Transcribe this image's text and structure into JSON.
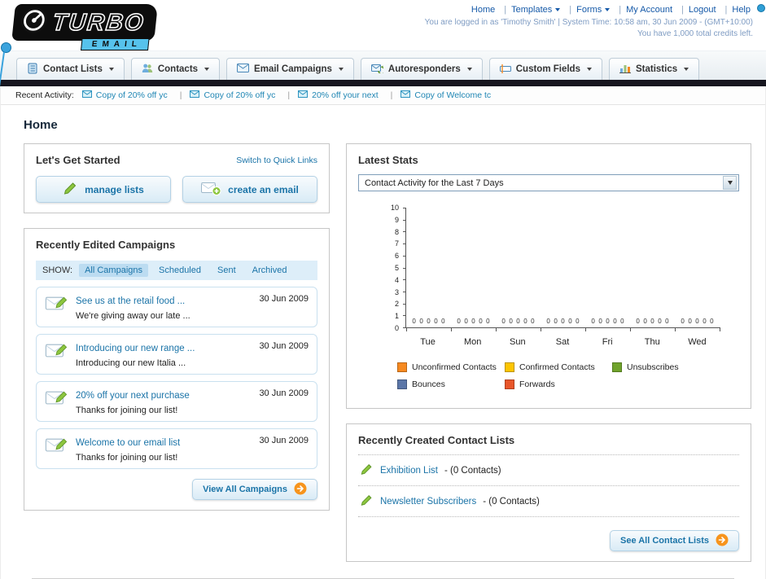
{
  "header": {
    "logo": {
      "title": "TURBO",
      "subtitle": "EMAIL"
    },
    "links": [
      "Home",
      "Templates",
      "Forms",
      "My Account",
      "Logout",
      "Help"
    ],
    "login_info": "You are logged in as 'Timothy Smith' | System Time: 10:58 am, 30 Jun 2009 - (GMT+10:00)",
    "credits_info": "You have 1,000 total credits left."
  },
  "nav": {
    "tabs": [
      {
        "label": "Contact Lists"
      },
      {
        "label": "Contacts"
      },
      {
        "label": "Email Campaigns"
      },
      {
        "label": "Autoresponders"
      },
      {
        "label": "Custom Fields"
      },
      {
        "label": "Statistics"
      }
    ]
  },
  "recent_activity": {
    "label": "Recent Activity:",
    "items": [
      {
        "text": "Copy of 20% off yc"
      },
      {
        "text": "Copy of 20% off yc"
      },
      {
        "text": "20% off your next"
      },
      {
        "text": "Copy of Welcome tc"
      }
    ]
  },
  "page": {
    "title": "Home"
  },
  "get_started": {
    "title": "Let's Get Started",
    "switch_link": "Switch to Quick Links",
    "manage_lists_label": "manage lists",
    "create_email_label": "create an email"
  },
  "campaigns": {
    "title": "Recently Edited Campaigns",
    "show_label": "SHOW:",
    "filters": [
      {
        "label": "All Campaigns"
      },
      {
        "label": "Scheduled"
      },
      {
        "label": "Sent"
      },
      {
        "label": "Archived"
      }
    ],
    "items": [
      {
        "title": "See us at the retail food ...",
        "subtitle": "We're giving away our late ...",
        "date": "30 Jun 2009"
      },
      {
        "title": "Introducing our new range ...",
        "subtitle": "Introducing our new Italia ...",
        "date": "30 Jun 2009"
      },
      {
        "title": "20% off your next purchase",
        "subtitle": "Thanks for joining our list!",
        "date": "30 Jun 2009"
      },
      {
        "title": "Welcome to our email list",
        "subtitle": "Thanks for joining our list!",
        "date": "30 Jun 2009"
      }
    ],
    "view_all_label": "View All Campaigns"
  },
  "stats": {
    "title": "Latest Stats",
    "period_value": "Contact Activity for the Last 7 Days",
    "legend": [
      {
        "label": "Unconfirmed Contacts",
        "color": "#f6891f"
      },
      {
        "label": "Confirmed Contacts",
        "color": "#fdc500"
      },
      {
        "label": "Unsubscribes",
        "color": "#6fa32b"
      },
      {
        "label": "Bounces",
        "color": "#5b76a8"
      },
      {
        "label": "Forwards",
        "color": "#e8562a"
      }
    ]
  },
  "chart_data": {
    "type": "bar",
    "title": "Contact Activity for the Last 7 Days",
    "categories": [
      "Tue",
      "Mon",
      "Sun",
      "Sat",
      "Fri",
      "Thu",
      "Wed"
    ],
    "series": [
      {
        "name": "Unconfirmed Contacts",
        "color": "#f6891f",
        "values": [
          0,
          0,
          0,
          0,
          0,
          0,
          0
        ]
      },
      {
        "name": "Confirmed Contacts",
        "color": "#fdc500",
        "values": [
          0,
          0,
          0,
          0,
          0,
          0,
          0
        ]
      },
      {
        "name": "Unsubscribes",
        "color": "#6fa32b",
        "values": [
          0,
          0,
          0,
          0,
          0,
          0,
          0
        ]
      },
      {
        "name": "Bounces",
        "color": "#5b76a8",
        "values": [
          0,
          0,
          0,
          0,
          0,
          0,
          0
        ]
      },
      {
        "name": "Forwards",
        "color": "#e8562a",
        "values": [
          0,
          0,
          0,
          0,
          0,
          0,
          0
        ]
      }
    ],
    "ylim": [
      0,
      10
    ],
    "yticks": [
      0,
      1,
      2,
      3,
      4,
      5,
      6,
      7,
      8,
      9,
      10
    ],
    "xlabel": "",
    "ylabel": "",
    "grid": false,
    "legend_position": "bottom"
  },
  "contact_lists": {
    "title": "Recently Created Contact Lists",
    "items": [
      {
        "name": "Exhibition List",
        "meta": "- (0 Contacts)"
      },
      {
        "name": "Newsletter Subscribers",
        "meta": "- (0 Contacts)"
      }
    ],
    "see_all_label": "See All Contact Lists"
  }
}
